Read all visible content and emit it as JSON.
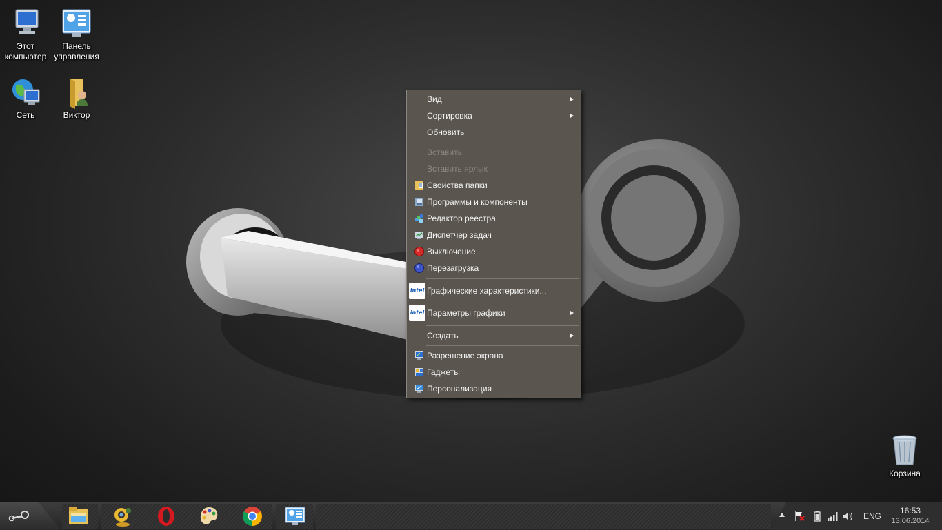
{
  "desktop": {
    "icons": [
      {
        "name": "this-computer",
        "label": "Этот\nкомпьютер"
      },
      {
        "name": "control-panel",
        "label": "Панель\nуправления"
      },
      {
        "name": "network",
        "label": "Сеть"
      },
      {
        "name": "user-folder",
        "label": "Виктор"
      },
      {
        "name": "recycle-bin",
        "label": "Корзина"
      }
    ]
  },
  "context_menu": {
    "items": [
      {
        "label": "Вид",
        "submenu": true,
        "enabled": true
      },
      {
        "label": "Сортировка",
        "submenu": true,
        "enabled": true
      },
      {
        "label": "Обновить",
        "submenu": false,
        "enabled": true
      },
      {
        "label": "Вставить",
        "submenu": false,
        "enabled": false
      },
      {
        "label": "Вставить ярлык",
        "submenu": false,
        "enabled": false
      },
      {
        "label": "Свойства папки",
        "icon": "folder-options-icon",
        "enabled": true
      },
      {
        "label": "Программы и компоненты",
        "icon": "programs-features-icon",
        "enabled": true
      },
      {
        "label": "Редактор реестра",
        "icon": "registry-editor-icon",
        "enabled": true
      },
      {
        "label": "Диспетчер задач",
        "icon": "task-manager-icon",
        "enabled": true
      },
      {
        "label": "Выключение",
        "icon": "shutdown-icon",
        "enabled": true
      },
      {
        "label": "Перезагрузка",
        "icon": "restart-icon",
        "enabled": true
      },
      {
        "label": "Графические характеристики...",
        "icon": "intel-graphics-icon",
        "enabled": true
      },
      {
        "label": "Параметры графики",
        "icon": "intel-graphics-icon",
        "submenu": true,
        "enabled": true
      },
      {
        "label": "Создать",
        "submenu": true,
        "enabled": true
      },
      {
        "label": "Разрешение экрана",
        "icon": "screen-resolution-icon",
        "enabled": true
      },
      {
        "label": "Гаджеты",
        "icon": "gadgets-icon",
        "enabled": true
      },
      {
        "label": "Персонализация",
        "icon": "personalization-icon",
        "enabled": true
      }
    ],
    "intel_badge": "intel"
  },
  "taskbar": {
    "pinned": [
      "file-explorer-icon",
      "webcam-icon",
      "opera-icon",
      "paint-icon",
      "chrome-icon",
      "control-panel-icon"
    ],
    "tray": {
      "language": "ENG",
      "time": "16:53",
      "date": "13.06.2014"
    }
  },
  "colors": {
    "menu_bg": "#5a554e",
    "menu_border": "#8a8680",
    "disabled_text": "#8c8882"
  }
}
